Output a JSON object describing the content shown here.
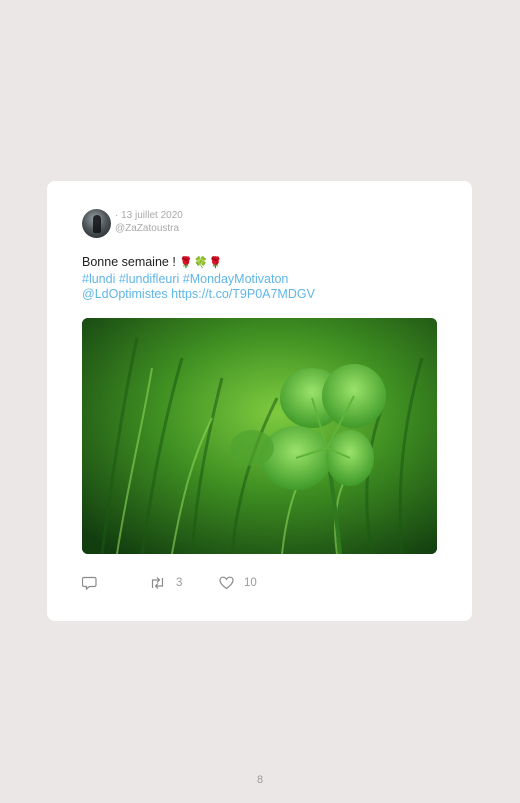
{
  "tweet": {
    "date": "13 juillet 2020",
    "handle": "@ZaZatoustra",
    "text": "Bonne semaine !",
    "emojis": "🌹🍀🌹",
    "hashtags": "#lundi #lundifleuri #MondayMotivaton",
    "mention": "@LdOptimistes",
    "url": "https://t.co/T9P0A7MDGV"
  },
  "media": {
    "icon": "four-leaf-clover-photo"
  },
  "actions": {
    "reply_icon": "reply-icon",
    "retweet_icon": "retweet-icon",
    "retweets": "3",
    "like_icon": "heart-icon",
    "likes": "10"
  },
  "colors": {
    "background": "#ece7e7",
    "card": "#ffffff",
    "link": "#5fb6e8"
  },
  "page": {
    "number": "8"
  }
}
